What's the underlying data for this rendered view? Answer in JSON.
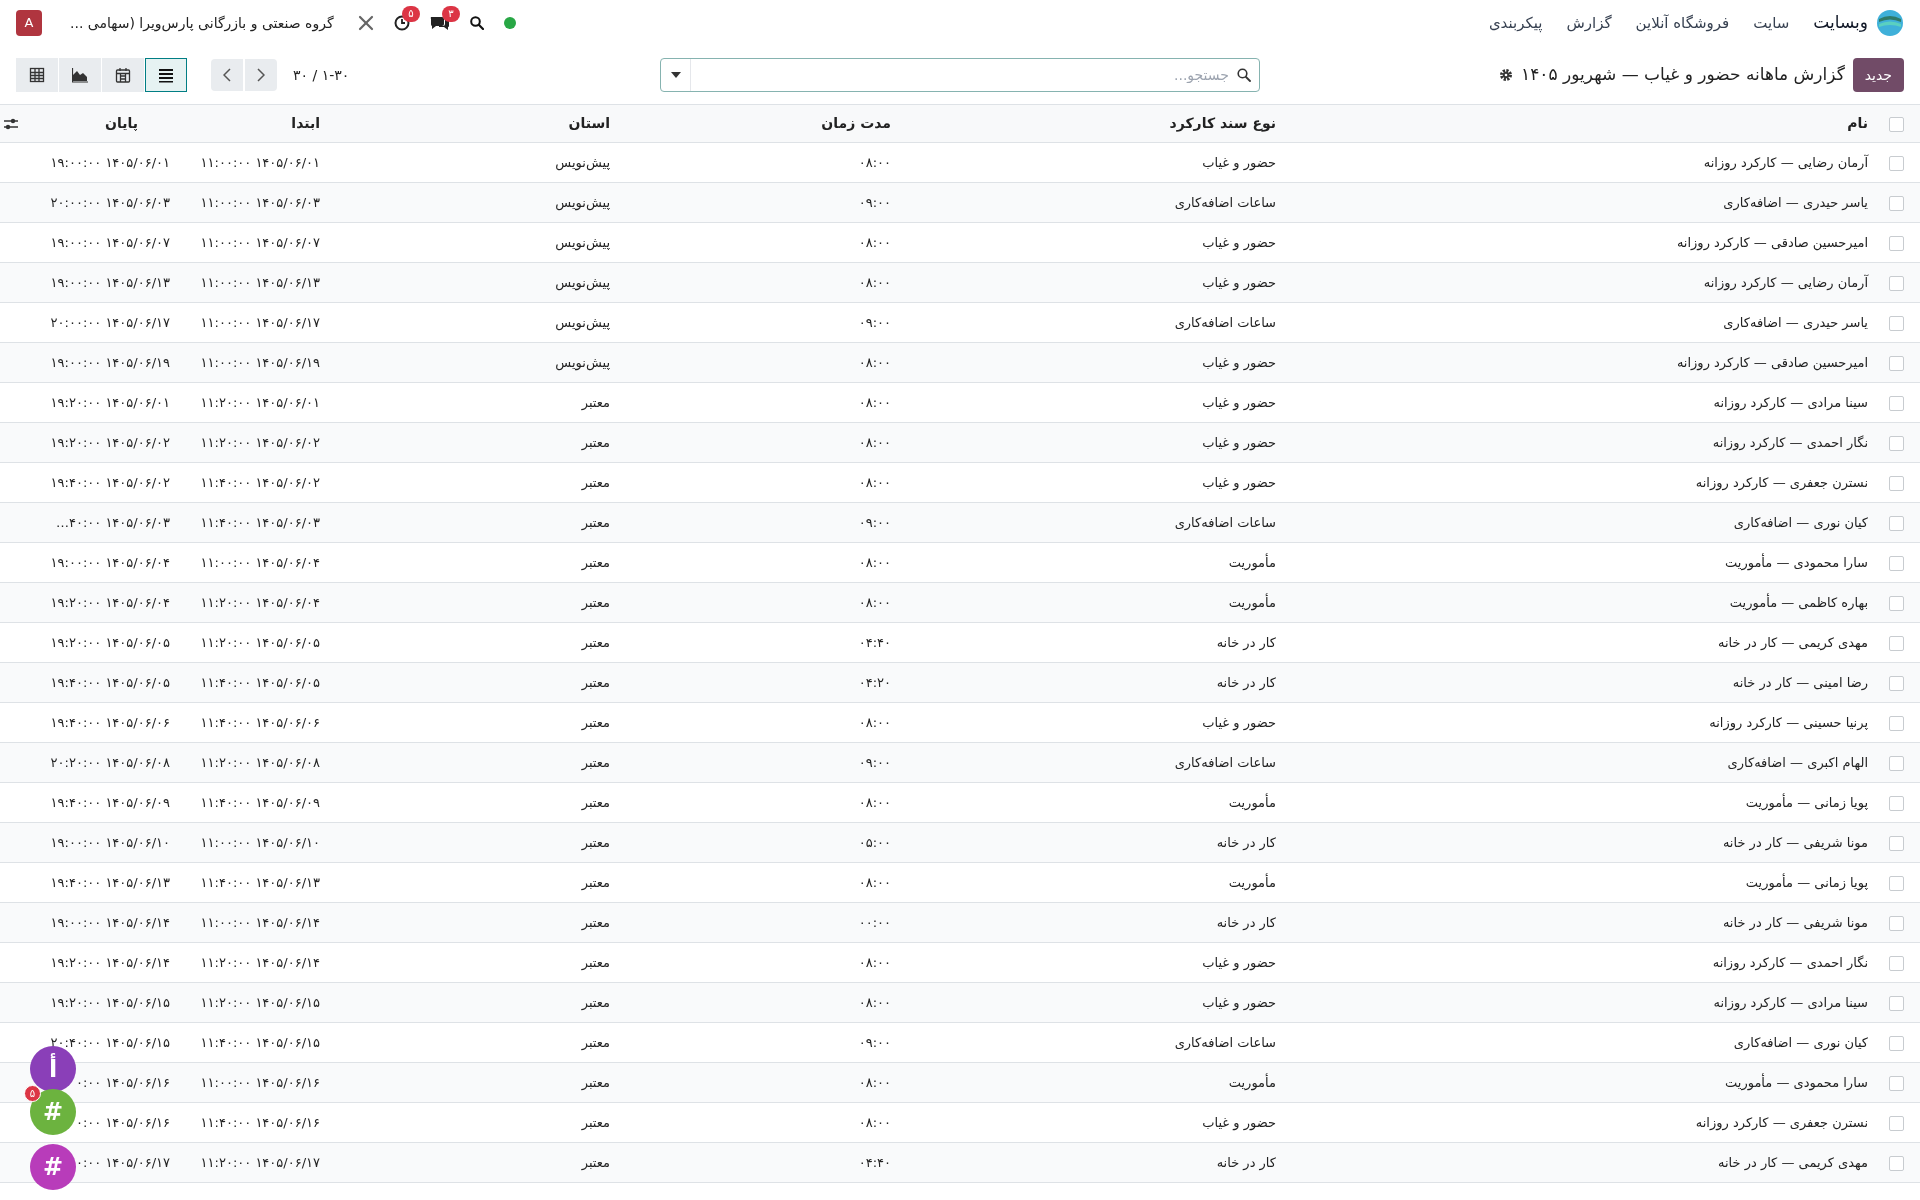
{
  "navbar": {
    "app_name": "وبسایت",
    "menu": [
      "سایت",
      "فروشگاه آنلاین",
      "گزارش",
      "پیکربندی"
    ],
    "chat_count": "۳",
    "activity_count": "۵",
    "company": "گروه صنعتی و بازرگانی پارس‌ویرا (سهامی ...",
    "avatar": "A"
  },
  "control_panel": {
    "new_button": "جدید",
    "title": "گزارش ماهانه حضور و غیاب — شهریور ۱۴۰۵",
    "search": {
      "placeholder": "جستجو..."
    },
    "pager": "۱-۳۰ / ۳۰",
    "views": [
      {
        "kind": "list",
        "selected": true
      },
      {
        "kind": "calendar",
        "selected": false
      },
      {
        "kind": "graph",
        "selected": false
      },
      {
        "kind": "pivot",
        "selected": false
      }
    ]
  },
  "table": {
    "columns": [
      "نام",
      "نوع سند کارکرد",
      "مدت زمان",
      "استان",
      "ابتدا",
      "پایان"
    ],
    "all_checked": false,
    "rows": [
      {
        "checked": false,
        "cells": [
          "آرمان رضایی — کارکرد روزانه",
          "حضور و غیاب",
          "۰۸:۰۰",
          "پیش‌نویس",
          "۱۴۰۵/۰۶/۰۱ ۱۱:۰۰:۰۰",
          "۱۴۰۵/۰۶/۰۱ ۱۹:۰۰:۰۰"
        ]
      },
      {
        "checked": false,
        "cells": [
          "یاسر حیدری — اضافه‌کاری",
          "ساعات اضافه‌کاری",
          "۰۹:۰۰",
          "پیش‌نویس",
          "۱۴۰۵/۰۶/۰۳ ۱۱:۰۰:۰۰",
          "۱۴۰۵/۰۶/۰۳ ۲۰:۰۰:۰۰"
        ]
      },
      {
        "checked": false,
        "cells": [
          "امیرحسین صادقی — کارکرد روزانه",
          "حضور و غیاب",
          "۰۸:۰۰",
          "پیش‌نویس",
          "۱۴۰۵/۰۶/۰۷ ۱۱:۰۰:۰۰",
          "۱۴۰۵/۰۶/۰۷ ۱۹:۰۰:۰۰"
        ]
      },
      {
        "checked": false,
        "cells": [
          "آرمان رضایی — کارکرد روزانه",
          "حضور و غیاب",
          "۰۸:۰۰",
          "پیش‌نویس",
          "۱۴۰۵/۰۶/۱۳ ۱۱:۰۰:۰۰",
          "۱۴۰۵/۰۶/۱۳ ۱۹:۰۰:۰۰"
        ]
      },
      {
        "checked": false,
        "cells": [
          "یاسر حیدری — اضافه‌کاری",
          "ساعات اضافه‌کاری",
          "۰۹:۰۰",
          "پیش‌نویس",
          "۱۴۰۵/۰۶/۱۷ ۱۱:۰۰:۰۰",
          "۱۴۰۵/۰۶/۱۷ ۲۰:۰۰:۰۰"
        ]
      },
      {
        "checked": false,
        "cells": [
          "امیرحسین صادقی — کارکرد روزانه",
          "حضور و غیاب",
          "۰۸:۰۰",
          "پیش‌نویس",
          "۱۴۰۵/۰۶/۱۹ ۱۱:۰۰:۰۰",
          "۱۴۰۵/۰۶/۱۹ ۱۹:۰۰:۰۰"
        ]
      },
      {
        "checked": false,
        "cells": [
          "سینا مرادی — کارکرد روزانه",
          "حضور و غیاب",
          "۰۸:۰۰",
          "معتبر",
          "۱۴۰۵/۰۶/۰۱ ۱۱:۲۰:۰۰",
          "۱۴۰۵/۰۶/۰۱ ۱۹:۲۰:۰۰"
        ]
      },
      {
        "checked": false,
        "cells": [
          "نگار احمدی — کارکرد روزانه",
          "حضور و غیاب",
          "۰۸:۰۰",
          "معتبر",
          "۱۴۰۵/۰۶/۰۲ ۱۱:۲۰:۰۰",
          "۱۴۰۵/۰۶/۰۲ ۱۹:۲۰:۰۰"
        ]
      },
      {
        "checked": false,
        "cells": [
          "نسترن جعفری — کارکرد روزانه",
          "حضور و غیاب",
          "۰۸:۰۰",
          "معتبر",
          "۱۴۰۵/۰۶/۰۲ ۱۱:۴۰:۰۰",
          "۱۴۰۵/۰۶/۰۲ ۱۹:۴۰:۰۰"
        ]
      },
      {
        "checked": false,
        "cells": [
          "کیان نوری — اضافه‌کاری",
          "ساعات اضافه‌کاری",
          "۰۹:۰۰",
          "معتبر",
          "۱۴۰۵/۰۶/۰۳ ۱۱:۴۰:۰۰",
          "۱۴۰۵/۰۶/۰۳ ۴۰:۰۰…"
        ]
      },
      {
        "checked": false,
        "cells": [
          "سارا محمودی — مأموریت",
          "مأموریت",
          "۰۸:۰۰",
          "معتبر",
          "۱۴۰۵/۰۶/۰۴ ۱۱:۰۰:۰۰",
          "۱۴۰۵/۰۶/۰۴ ۱۹:۰۰:۰۰"
        ]
      },
      {
        "checked": false,
        "cells": [
          "بهاره کاظمی — مأموریت",
          "مأموریت",
          "۰۸:۰۰",
          "معتبر",
          "۱۴۰۵/۰۶/۰۴ ۱۱:۲۰:۰۰",
          "۱۴۰۵/۰۶/۰۴ ۱۹:۲۰:۰۰"
        ]
      },
      {
        "checked": false,
        "cells": [
          "مهدی کریمی — کار در خانه",
          "کار در خانه",
          "۰۴:۴۰",
          "معتبر",
          "۱۴۰۵/۰۶/۰۵ ۱۱:۲۰:۰۰",
          "۱۴۰۵/۰۶/۰۵ ۱۹:۲۰:۰۰"
        ]
      },
      {
        "checked": false,
        "cells": [
          "رضا امینی — کار در خانه",
          "کار در خانه",
          "۰۴:۲۰",
          "معتبر",
          "۱۴۰۵/۰۶/۰۵ ۱۱:۴۰:۰۰",
          "۱۴۰۵/۰۶/۰۵ ۱۹:۴۰:۰۰"
        ]
      },
      {
        "checked": false,
        "cells": [
          "پرنیا حسینی — کارکرد روزانه",
          "حضور و غیاب",
          "۰۸:۰۰",
          "معتبر",
          "۱۴۰۵/۰۶/۰۶ ۱۱:۴۰:۰۰",
          "۱۴۰۵/۰۶/۰۶ ۱۹:۴۰:۰۰"
        ]
      },
      {
        "checked": false,
        "cells": [
          "الهام اکبری — اضافه‌کاری",
          "ساعات اضافه‌کاری",
          "۰۹:۰۰",
          "معتبر",
          "۱۴۰۵/۰۶/۰۸ ۱۱:۲۰:۰۰",
          "۱۴۰۵/۰۶/۰۸ ۲۰:۲۰:۰۰"
        ]
      },
      {
        "checked": false,
        "cells": [
          "پویا زمانی — مأموریت",
          "مأموریت",
          "۰۸:۰۰",
          "معتبر",
          "۱۴۰۵/۰۶/۰۹ ۱۱:۴۰:۰۰",
          "۱۴۰۵/۰۶/۰۹ ۱۹:۴۰:۰۰"
        ]
      },
      {
        "checked": false,
        "cells": [
          "مونا شریفی — کار در خانه",
          "کار در خانه",
          "۰۵:۰۰",
          "معتبر",
          "۱۴۰۵/۰۶/۱۰ ۱۱:۰۰:۰۰",
          "۱۴۰۵/۰۶/۱۰ ۱۹:۰۰:۰۰"
        ]
      },
      {
        "checked": false,
        "cells": [
          "پویا زمانی — مأموریت",
          "مأموریت",
          "۰۸:۰۰",
          "معتبر",
          "۱۴۰۵/۰۶/۱۳ ۱۱:۴۰:۰۰",
          "۱۴۰۵/۰۶/۱۳ ۱۹:۴۰:۰۰"
        ]
      },
      {
        "checked": false,
        "cells": [
          "مونا شریفی — کار در خانه",
          "کار در خانه",
          "۰۰:۰۰",
          "معتبر",
          "۱۴۰۵/۰۶/۱۴ ۱۱:۰۰:۰۰",
          "۱۴۰۵/۰۶/۱۴ ۱۹:۰۰:۰۰"
        ]
      },
      {
        "checked": false,
        "cells": [
          "نگار احمدی — کارکرد روزانه",
          "حضور و غیاب",
          "۰۸:۰۰",
          "معتبر",
          "۱۴۰۵/۰۶/۱۴ ۱۱:۲۰:۰۰",
          "۱۴۰۵/۰۶/۱۴ ۱۹:۲۰:۰۰"
        ]
      },
      {
        "checked": false,
        "cells": [
          "سینا مرادی — کارکرد روزانه",
          "حضور و غیاب",
          "۰۸:۰۰",
          "معتبر",
          "۱۴۰۵/۰۶/۱۵ ۱۱:۲۰:۰۰",
          "۱۴۰۵/۰۶/۱۵ ۱۹:۲۰:۰۰"
        ]
      },
      {
        "checked": false,
        "cells": [
          "کیان نوری — اضافه‌کاری",
          "ساعات اضافه‌کاری",
          "۰۹:۰۰",
          "معتبر",
          "۱۴۰۵/۰۶/۱۵ ۱۱:۴۰:۰۰",
          "۱۴۰۵/۰۶/۱۵ ۲۰:۴۰:۰۰"
        ]
      },
      {
        "checked": false,
        "cells": [
          "سارا محمودی — مأموریت",
          "مأموریت",
          "۰۸:۰۰",
          "معتبر",
          "۱۴۰۵/۰۶/۱۶ ۱۱:۰۰:۰۰",
          "۱۴۰۵/۰۶/۱۶ ۰:۰۰"
        ]
      },
      {
        "checked": false,
        "cells": [
          "نسترن جعفری — کارکرد روزانه",
          "حضور و غیاب",
          "۰۸:۰۰",
          "معتبر",
          "۱۴۰۵/۰۶/۱۶ ۱۱:۴۰:۰۰",
          "۱۴۰۵/۰۶/۱۶ ۰:۰۰"
        ]
      },
      {
        "checked": false,
        "cells": [
          "مهدی کریمی — کار در خانه",
          "کار در خانه",
          "۰۴:۴۰",
          "معتبر",
          "۱۴۰۵/۰۶/۱۷ ۱۱:۲۰:۰۰",
          "۱۴۰۵/۰۶/۱۷ ۰:۰۰"
        ]
      }
    ]
  },
  "chat_bubbles": [
    {
      "label": "أ",
      "color": "#8a3fb8"
    },
    {
      "label": "#",
      "color": "#6cb33f",
      "badge": "۵"
    },
    {
      "label": "#",
      "color": "#b83cba"
    }
  ]
}
